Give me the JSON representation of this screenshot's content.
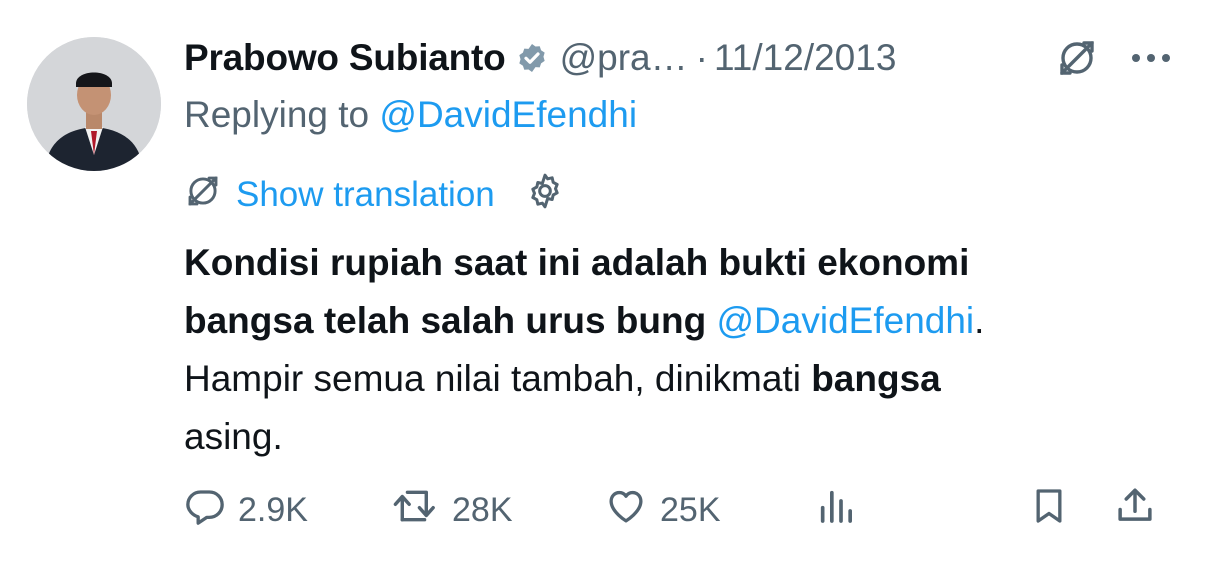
{
  "tweet": {
    "author": {
      "name": "Prabowo Subianto",
      "handle": "@pra…",
      "verified": true
    },
    "separator": "·",
    "date": "11/12/2013",
    "replying_prefix": "Replying to ",
    "replying_to": "@DavidEfendhi",
    "show_translation": "Show translation",
    "text": {
      "line1_bold": "Kondisi rupiah saat ini adalah bukti ekonomi",
      "line2_bold": "bangsa telah salah urus bung ",
      "mention": "@DavidEfendhi",
      "line2_end": ".",
      "line3_regular": "Hampir semua nilai tambah, dinikmati ",
      "line3_bold": "bangsa",
      "line4_regular": "asing."
    },
    "actions": {
      "replies": "2.9K",
      "retweets": "28K",
      "likes": "25K"
    },
    "colors": {
      "link": "#1d9bf0",
      "secondary": "#536471",
      "text": "#0f1419"
    },
    "icons": [
      "verified-badge-icon",
      "translate-icon",
      "more-icon",
      "gear-icon",
      "reply-icon",
      "retweet-icon",
      "like-icon",
      "views-icon",
      "bookmark-icon",
      "share-icon"
    ]
  }
}
